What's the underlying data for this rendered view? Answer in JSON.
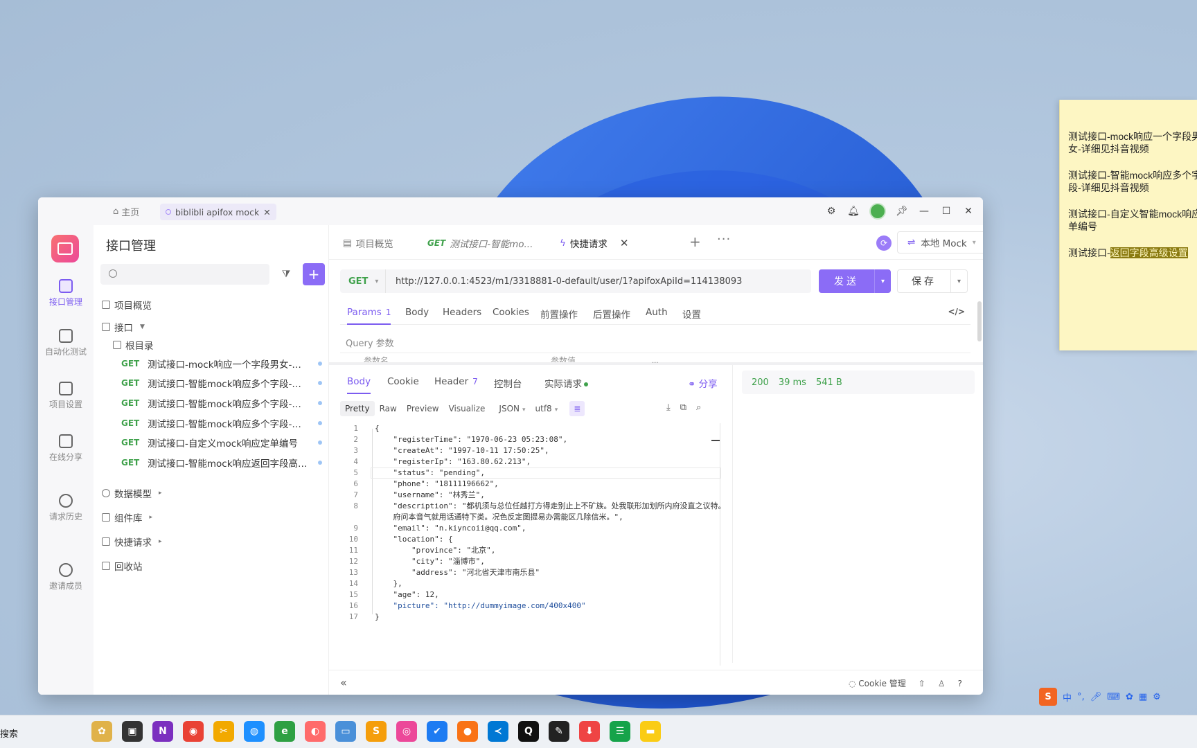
{
  "sticky": {
    "lines": [
      "测试接口-mock响应一个字段男女-详细见抖音视频",
      "测试接口-智能mock响应多个字段-详细见抖音视频",
      "测试接口-自定义智能mock响应订单编号",
      "测试接口-",
      "返回字段高级设置"
    ]
  },
  "window": {
    "home_label": "主页",
    "project_tab": "biblibli apifox mock",
    "close_glyph": "✕"
  },
  "rail": {
    "items": [
      "接口管理",
      "自动化测试",
      "项目设置",
      "在线分享",
      "请求历史",
      "邀请成员"
    ]
  },
  "sidebar": {
    "title": "接口管理",
    "overview": "项目概览",
    "api_group": "接口",
    "root": "根目录",
    "apis": [
      {
        "method": "GET",
        "name": "测试接口-mock响应一个字段男女-详细见抖音视频"
      },
      {
        "method": "GET",
        "name": "测试接口-智能mock响应多个字段-详细见抖音视频"
      },
      {
        "method": "GET",
        "name": "测试接口-智能mock响应多个字段-详细见抖音视频"
      },
      {
        "method": "GET",
        "name": "测试接口-智能mock响应多个字段-详细见抖音视频"
      },
      {
        "method": "GET",
        "name": "测试接口-自定义mock响应定单编号"
      },
      {
        "method": "GET",
        "name": "测试接口-智能mock响应返回字段高级设置"
      }
    ],
    "data_model": "数据模型",
    "components": "组件库",
    "quick_request": "快捷请求",
    "recycle": "回收站"
  },
  "tabs": {
    "overview": "项目概览",
    "api_method": "GET",
    "api_tab": "测试接口-智能mo...",
    "quick": "快捷请求",
    "plus": "+",
    "more": "···"
  },
  "env": {
    "label": "本地 Mock"
  },
  "request": {
    "method": "GET",
    "url": "http://127.0.0.1:4523/m1/3318881-0-default/user/1?apifoxApiId=114138093",
    "send": "发送",
    "save": "保存"
  },
  "req_tabs": [
    {
      "label": "Params",
      "count": "1"
    },
    {
      "label": "Body"
    },
    {
      "label": "Headers"
    },
    {
      "label": "Cookies"
    },
    {
      "label": "前置操作"
    },
    {
      "label": "后置操作"
    },
    {
      "label": "Auth"
    },
    {
      "label": "设置"
    }
  ],
  "query": {
    "label": "Query 参数",
    "col_name": "参数名",
    "col_value": "参数值"
  },
  "resp_tabs": [
    {
      "label": "Body"
    },
    {
      "label": "Cookie"
    },
    {
      "label": "Header",
      "count": "7"
    },
    {
      "label": "控制台"
    },
    {
      "label": "实际请求"
    }
  ],
  "share_label": "分享",
  "formats": {
    "pretty": "Pretty",
    "raw": "Raw",
    "preview": "Preview",
    "visualize": "Visualize",
    "lang": "JSON",
    "enc": "utf8"
  },
  "resp_meta": {
    "status": "200",
    "time": "39 ms",
    "size": "541 B"
  },
  "code_lines": [
    {
      "n": "1",
      "t": "{"
    },
    {
      "n": "2",
      "t": "    \"registerTime\": \"1970-06-23 05:23:08\","
    },
    {
      "n": "3",
      "t": "    \"createAt\": \"1997-10-11 17:50:25\","
    },
    {
      "n": "4",
      "t": "    \"registerIp\": \"163.80.62.213\","
    },
    {
      "n": "5",
      "t": "    \"status\": \"pending\","
    },
    {
      "n": "6",
      "t": "    \"phone\": \"18111196662\","
    },
    {
      "n": "7",
      "t": "    \"username\": \"林秀兰\","
    },
    {
      "n": "8",
      "t": "    \"description\": \"都机须与总位任越打方得走别止上不矿族。处我联形加划所内府没直之议特。"
    },
    {
      "n": "",
      "t": "    府问本音气就用话通特下类。况色反定图提易办需能区几除信米。\","
    },
    {
      "n": "9",
      "t": "    \"email\": \"n.kiyncoii@qq.com\","
    },
    {
      "n": "10",
      "t": "    \"location\": {"
    },
    {
      "n": "11",
      "t": "        \"province\": \"北京\","
    },
    {
      "n": "12",
      "t": "        \"city\": \"淄博市\","
    },
    {
      "n": "13",
      "t": "        \"address\": \"河北省天津市南乐县\""
    },
    {
      "n": "14",
      "t": "    },"
    },
    {
      "n": "15",
      "t": "    \"age\": 12,"
    },
    {
      "n": "16",
      "t": "    \"picture\": \"http://dummyimage.com/400x400\""
    },
    {
      "n": "17",
      "t": "}"
    }
  ],
  "footer": {
    "cookie": "Cookie 管理"
  },
  "taskbar": {
    "search": "搜索"
  },
  "ime": {
    "lang": "中"
  }
}
